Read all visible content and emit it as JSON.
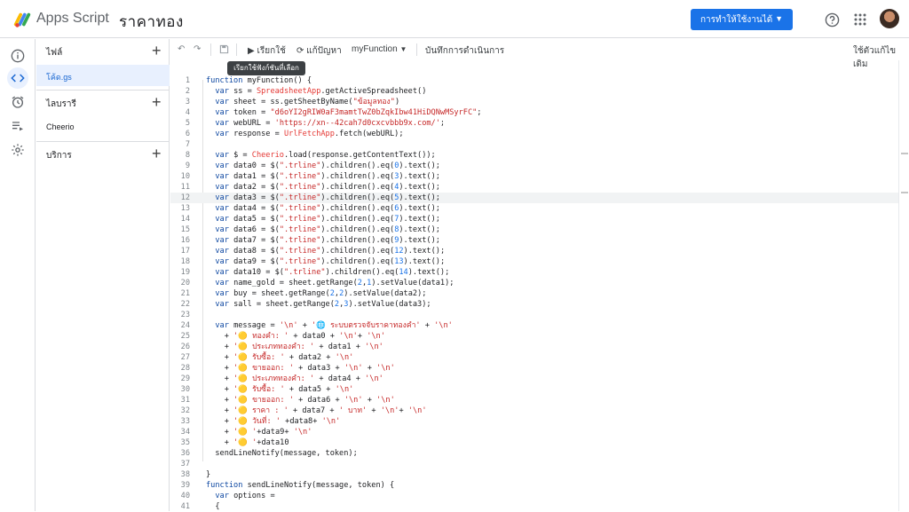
{
  "app_name": "Apps Script",
  "project_title": "ราคาทอง",
  "deploy_label": "การทำให้ใช้งานได้",
  "icons": [
    "help-icon",
    "apps-grid-icon",
    "avatar"
  ],
  "rail": [
    "info-icon",
    "code-icon",
    "triggers-icon",
    "executions-icon",
    "settings-icon"
  ],
  "files": {
    "section_label": "ไฟล์",
    "items": [
      "โค้ด.gs"
    ],
    "libraries_label": "ไลบรารี",
    "libraries": [
      "Cheerio"
    ],
    "services_label": "บริการ"
  },
  "toolbar": {
    "run_label": "เรียกใช้",
    "debug_label": "แก้ปัญหา",
    "function_select": "myFunction",
    "log_label": "บันทึกการดำเนินการ",
    "legacy_editor_label": "ใช้ตัวแก้ไขเดิม",
    "tooltip": "เรียกใช้ฟังก์ชันที่เลือก"
  },
  "code_lines": [
    "function myFunction() {",
    "  var ss = SpreadsheetApp.getActiveSpreadsheet()",
    "  var sheet = ss.getSheetByName(\"ข้อมูลทอง\")",
    "  var token = \"d6oYI2gRIW0aF3mamtTwZ0bZqkIbw41HiDQNwMSyrFC\";",
    "  var webURL = 'https://xn--42cah7d0cxcvbbb9x.com/';",
    "  var response = UrlFetchApp.fetch(webURL);",
    "",
    "  var $ = Cheerio.load(response.getContentText());",
    "  var data0 = $(\".trline\").children().eq(0).text();",
    "  var data1 = $(\".trline\").children().eq(3).text();",
    "  var data2 = $(\".trline\").children().eq(4).text();",
    "  var data3 = $(\".trline\").children().eq(5).text();",
    "  var data4 = $(\".trline\").children().eq(6).text();",
    "  var data5 = $(\".trline\").children().eq(7).text();",
    "  var data6 = $(\".trline\").children().eq(8).text();",
    "  var data7 = $(\".trline\").children().eq(9).text();",
    "  var data8 = $(\".trline\").children().eq(12).text();",
    "  var data9 = $(\".trline\").children().eq(13).text();",
    "  var data10 = $(\".trline\").children().eq(14).text();",
    "  var name_gold = sheet.getRange(2,1).setValue(data1);",
    "  var buy = sheet.getRange(2,2).setValue(data2);",
    "  var sall = sheet.getRange(2,3).setValue(data3);",
    "",
    "  var message = '\\n' + '🌐 ระบบตรวจจับราคาทองคำ' + '\\n'",
    "    + '🟡 ทองคำ: ' + data0 + '\\n'+ '\\n'",
    "    + '🟡 ประเภททองคำ: ' + data1 + '\\n'",
    "    + '🟡 รับซื้อ: ' + data2 + '\\n'",
    "    + '🟡 ขายออก: ' + data3 + '\\n' + '\\n'",
    "    + '🟡 ประเภททองคำ: ' + data4 + '\\n'",
    "    + '🟡 รับซื้อ: ' + data5 + '\\n'",
    "    + '🟡 ขายออก: ' + data6 + '\\n' + '\\n'",
    "    + '🟡 ราคา : ' + data7 + ' บาท' + '\\n'+ '\\n'",
    "    + '🟡 วันที่: ' +data8+ '\\n'",
    "    + '🟡 '+data9+ '\\n'",
    "    + '🟡 '+data10",
    "  sendLineNotify(message, token);",
    "",
    "}",
    "function sendLineNotify(message, token) {",
    "  var options =",
    "  {"
  ],
  "highlighted_line": 12
}
